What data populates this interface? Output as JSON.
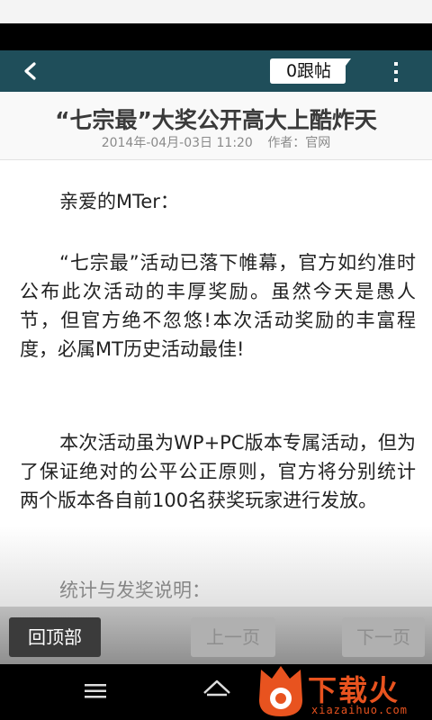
{
  "colors": {
    "action_bar": "#1f4e5a",
    "title_text": "#3a3a3a",
    "meta_text": "#8a8a8a",
    "watermark": "#e8531f"
  },
  "action_bar": {
    "back_icon": "chevron-left-icon",
    "reply_label": "0跟帖",
    "menu_icon": "more-vertical-icon"
  },
  "post": {
    "title": "“七宗最”大奖公开高大上酷炸天",
    "date": "2014年-04月-03日 11:20",
    "author": "作者：官网"
  },
  "content": {
    "paragraphs": [
      "亲爱的MTer：",
      "“七宗最”活动已落下帷幕，官方如约准时公布此次活动的丰厚奖励。虽然今天是愚人节，但官方绝不忽悠!本次活动奖励的丰富程度，必属MT历史活动最佳!",
      "本次活动虽为WP+PC版本专属活动，但为了保证绝对的公平公正原则，官方将分别统计两个版本各自前100名获奖玩家进行发放。",
      "统计与发奖说明："
    ]
  },
  "bottom_bar": {
    "top_label": "回顶部",
    "prev_label": "上一页",
    "next_label": "下一页"
  },
  "system_nav": {
    "icons": [
      "menu-icon",
      "home-icon"
    ]
  },
  "watermark": {
    "text": "下载火",
    "sub": "xiazaihuo.com"
  }
}
